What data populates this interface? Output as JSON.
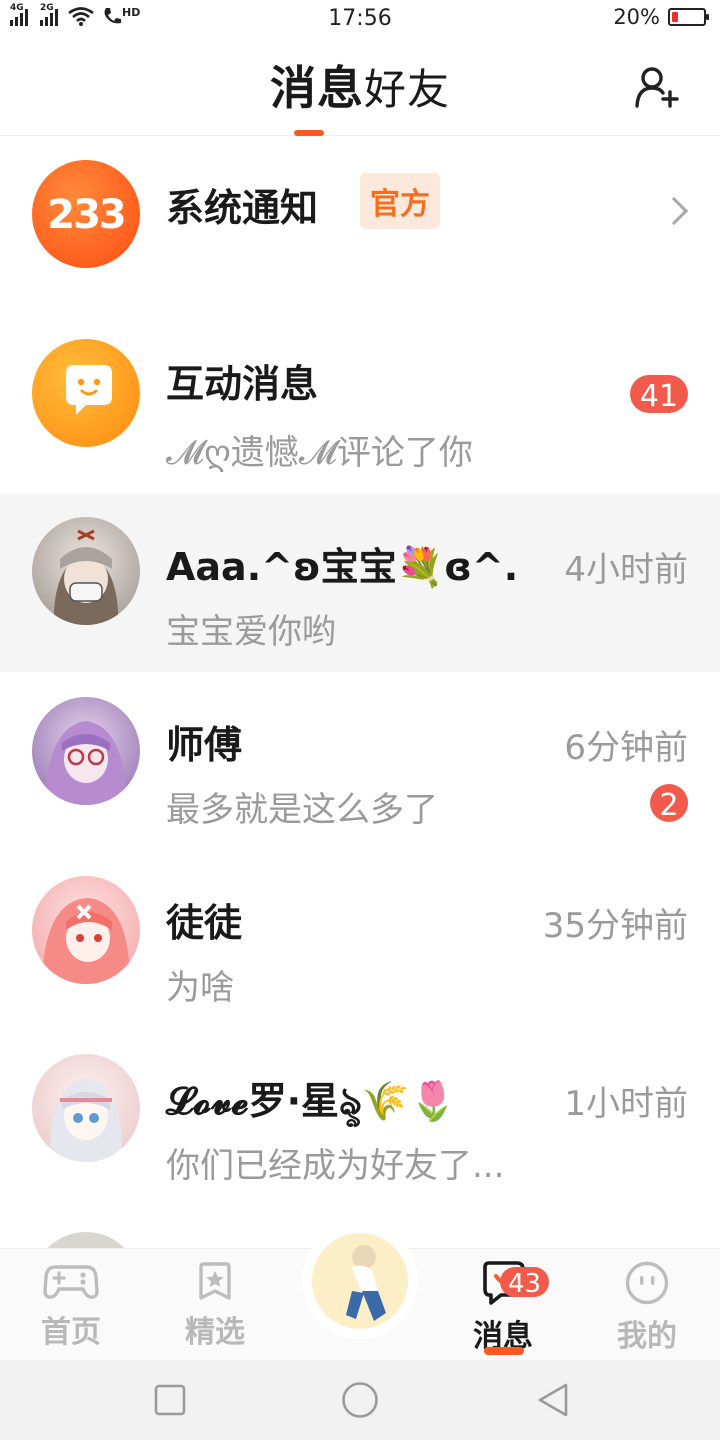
{
  "status_bar": {
    "network_1": "4G",
    "network_2": "2G",
    "hd": "HD",
    "time": "17:56",
    "battery_percent": "20%",
    "battery_level": 0.2,
    "battery_color": "#e8312f"
  },
  "header": {
    "tab_messages": "消息",
    "tab_friends": "好友",
    "add_friend_icon": "add-user-icon",
    "accent": "#ff5a1f"
  },
  "conversations": [
    {
      "name": "系统通知",
      "badge_label": "官方",
      "avatar_text": "233",
      "avatar_color": "#ff5a1f",
      "icon": "chevron-right-icon"
    },
    {
      "name": "互动消息",
      "preview": "𝓜ღ遗憾𝓜评论了你",
      "unread": "41",
      "avatar_color": "#ffa31a",
      "icon": "chat-bubble-icon"
    },
    {
      "name": "Aaa.^ʚ宝宝💐ɞ^.",
      "preview": "宝宝爱你哟",
      "time": "4小时前"
    },
    {
      "name": "师傅",
      "preview": "最多就是这么多了",
      "time": "6分钟前",
      "unread": "2"
    },
    {
      "name": "徒徒",
      "preview": "为啥",
      "time": "35分钟前"
    },
    {
      "name": "𝓛𝓸𝓿𝓮罗·星ৡ🌾🌷",
      "preview": "你们已经成为好友了...",
      "time": "1小时前"
    }
  ],
  "bottom_nav": {
    "home": "首页",
    "featured": "精选",
    "messages": "消息",
    "messages_badge": "43",
    "mine": "我的"
  }
}
